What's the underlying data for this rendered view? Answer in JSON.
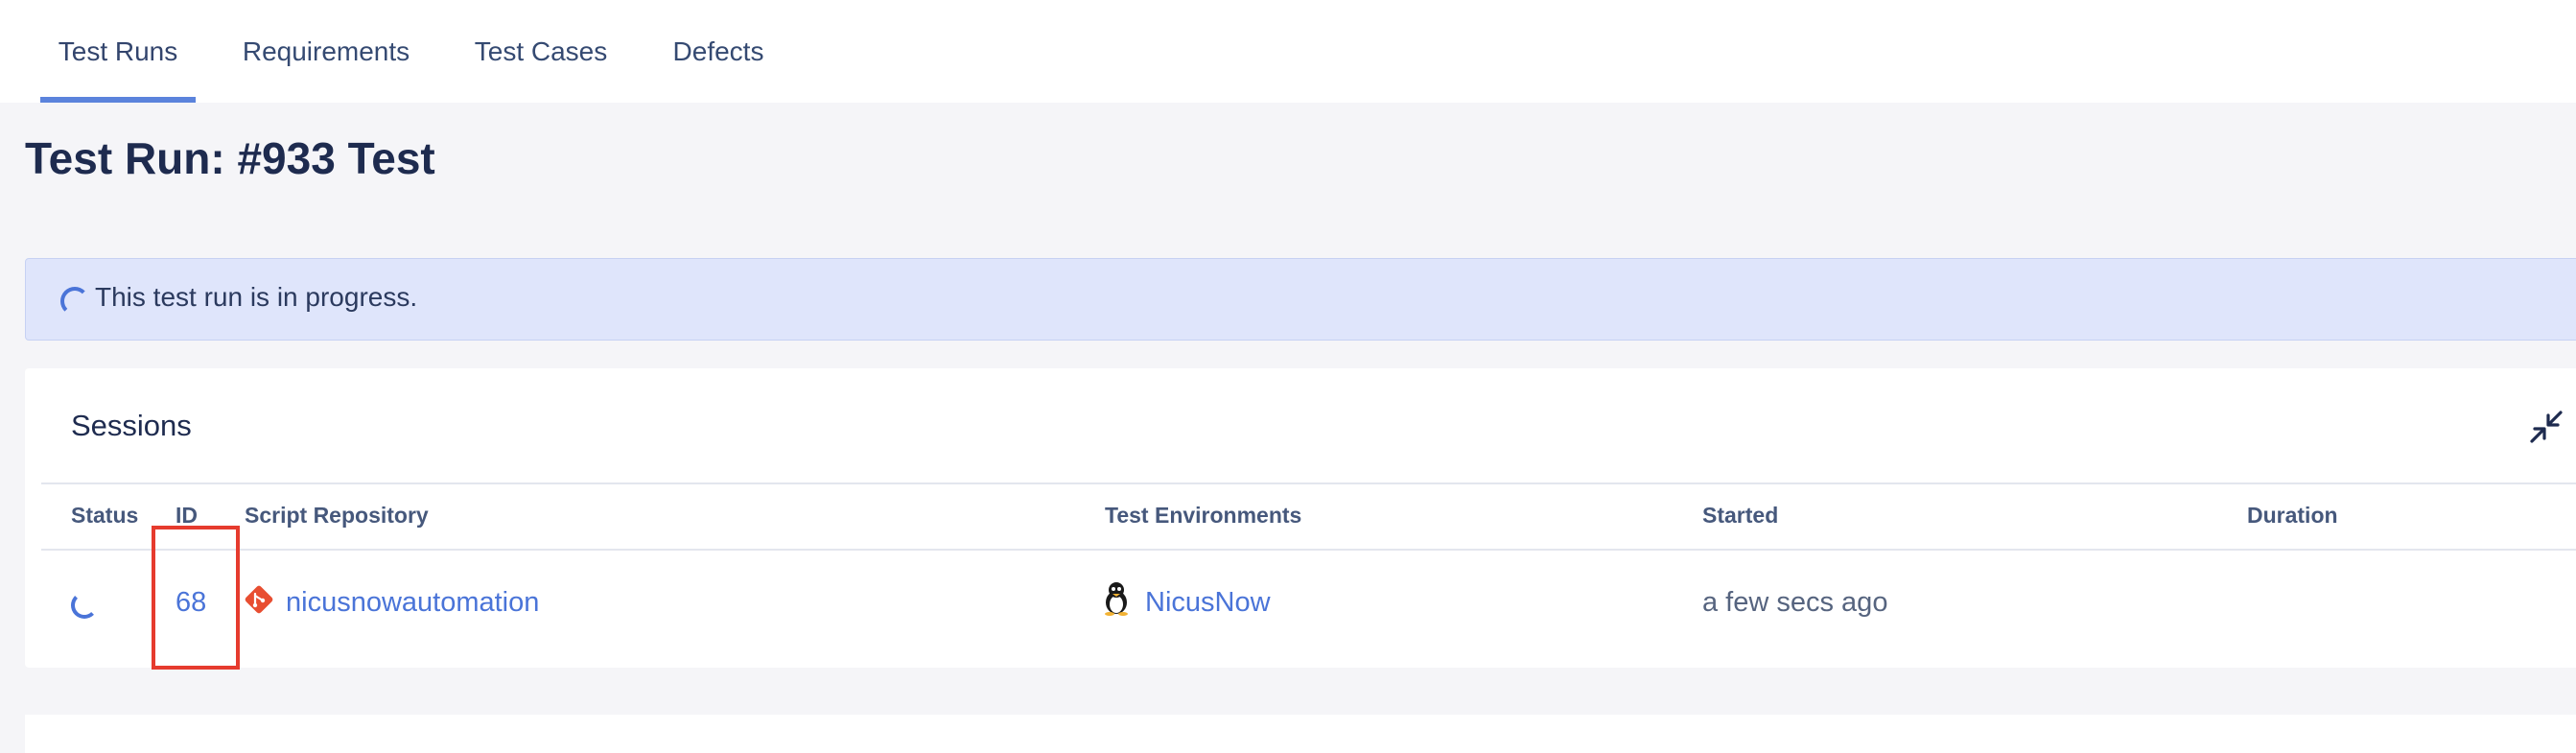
{
  "tabs": [
    {
      "label": "Test Runs",
      "active": true
    },
    {
      "label": "Requirements",
      "active": false
    },
    {
      "label": "Test Cases",
      "active": false
    },
    {
      "label": "Defects",
      "active": false
    }
  ],
  "page": {
    "title": "Test Run: #933 Test"
  },
  "banner": {
    "text": "This test run is in progress.",
    "icon": "spinner-icon"
  },
  "sessions": {
    "title": "Sessions",
    "collapse_icon": "collapse-icon",
    "columns": [
      "Status",
      "ID",
      "Script Repository",
      "Test Environments",
      "Started",
      "Duration"
    ],
    "rows": [
      {
        "status_icon": "spinner-icon",
        "id": "68",
        "repository": "nicusnowautomation",
        "repository_icon": "git-icon",
        "environment": "NicusNow",
        "environment_icon": "linux-icon",
        "started": "a few secs ago",
        "duration": ""
      }
    ]
  },
  "colors": {
    "accent": "#4a74d8",
    "banner_bg": "#dfe5fb",
    "highlight": "#e63b2e",
    "git": "#e84e31"
  }
}
